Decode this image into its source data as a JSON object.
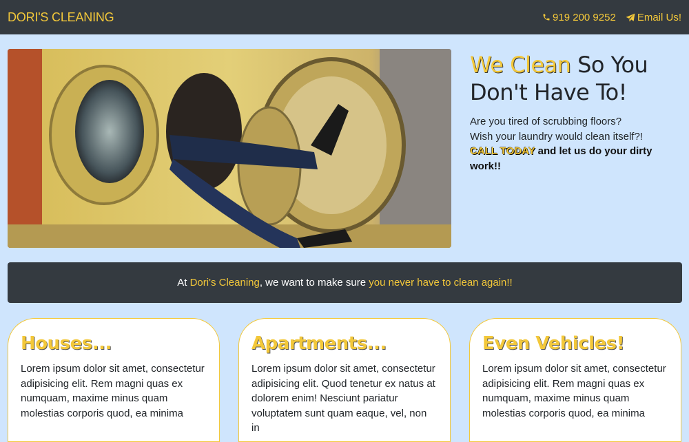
{
  "navbar": {
    "brand": "DORI'S CLEANING",
    "phone_label": "919 200 9252",
    "email_label": "Email Us!",
    "phone_icon": "phone-icon",
    "email_icon": "paper-plane-icon"
  },
  "hero": {
    "image": "laundromat-dryer-legs-photo",
    "title_highlight": "We Clean",
    "title_rest": " So You Don't Have To!",
    "line1": "Are you tired of scrubbing floors?",
    "line2": "Wish your laundry would clean itself?!",
    "cta": "CALL TODAY",
    "cta_rest": " and let us do your dirty work!!"
  },
  "banner": {
    "prefix": "At ",
    "company": "Dori's Cleaning",
    "middle": ", we want to make sure ",
    "emphasis": "you never have to clean again!!"
  },
  "cards": [
    {
      "title": "Houses...",
      "text": "Lorem ipsum dolor sit amet, consectetur adipisicing elit. Rem magni quas ex numquam, maxime minus quam molestias corporis quod, ea minima"
    },
    {
      "title": "Apartments...",
      "text": "Lorem ipsum dolor sit amet, consectetur adipisicing elit. Quod tenetur ex natus at dolorem enim! Nesciunt pariatur voluptatem sunt quam eaque, vel, non in"
    },
    {
      "title": "Even Vehicles!",
      "text": "Lorem ipsum dolor sit amet, consectetur adipisicing elit. Rem magni quas ex numquam, maxime minus quam molestias corporis quod, ea minima"
    }
  ],
  "colors": {
    "accent": "#f3c83a",
    "navbar_bg": "#343a40",
    "page_bg": "#cfe5fd"
  }
}
